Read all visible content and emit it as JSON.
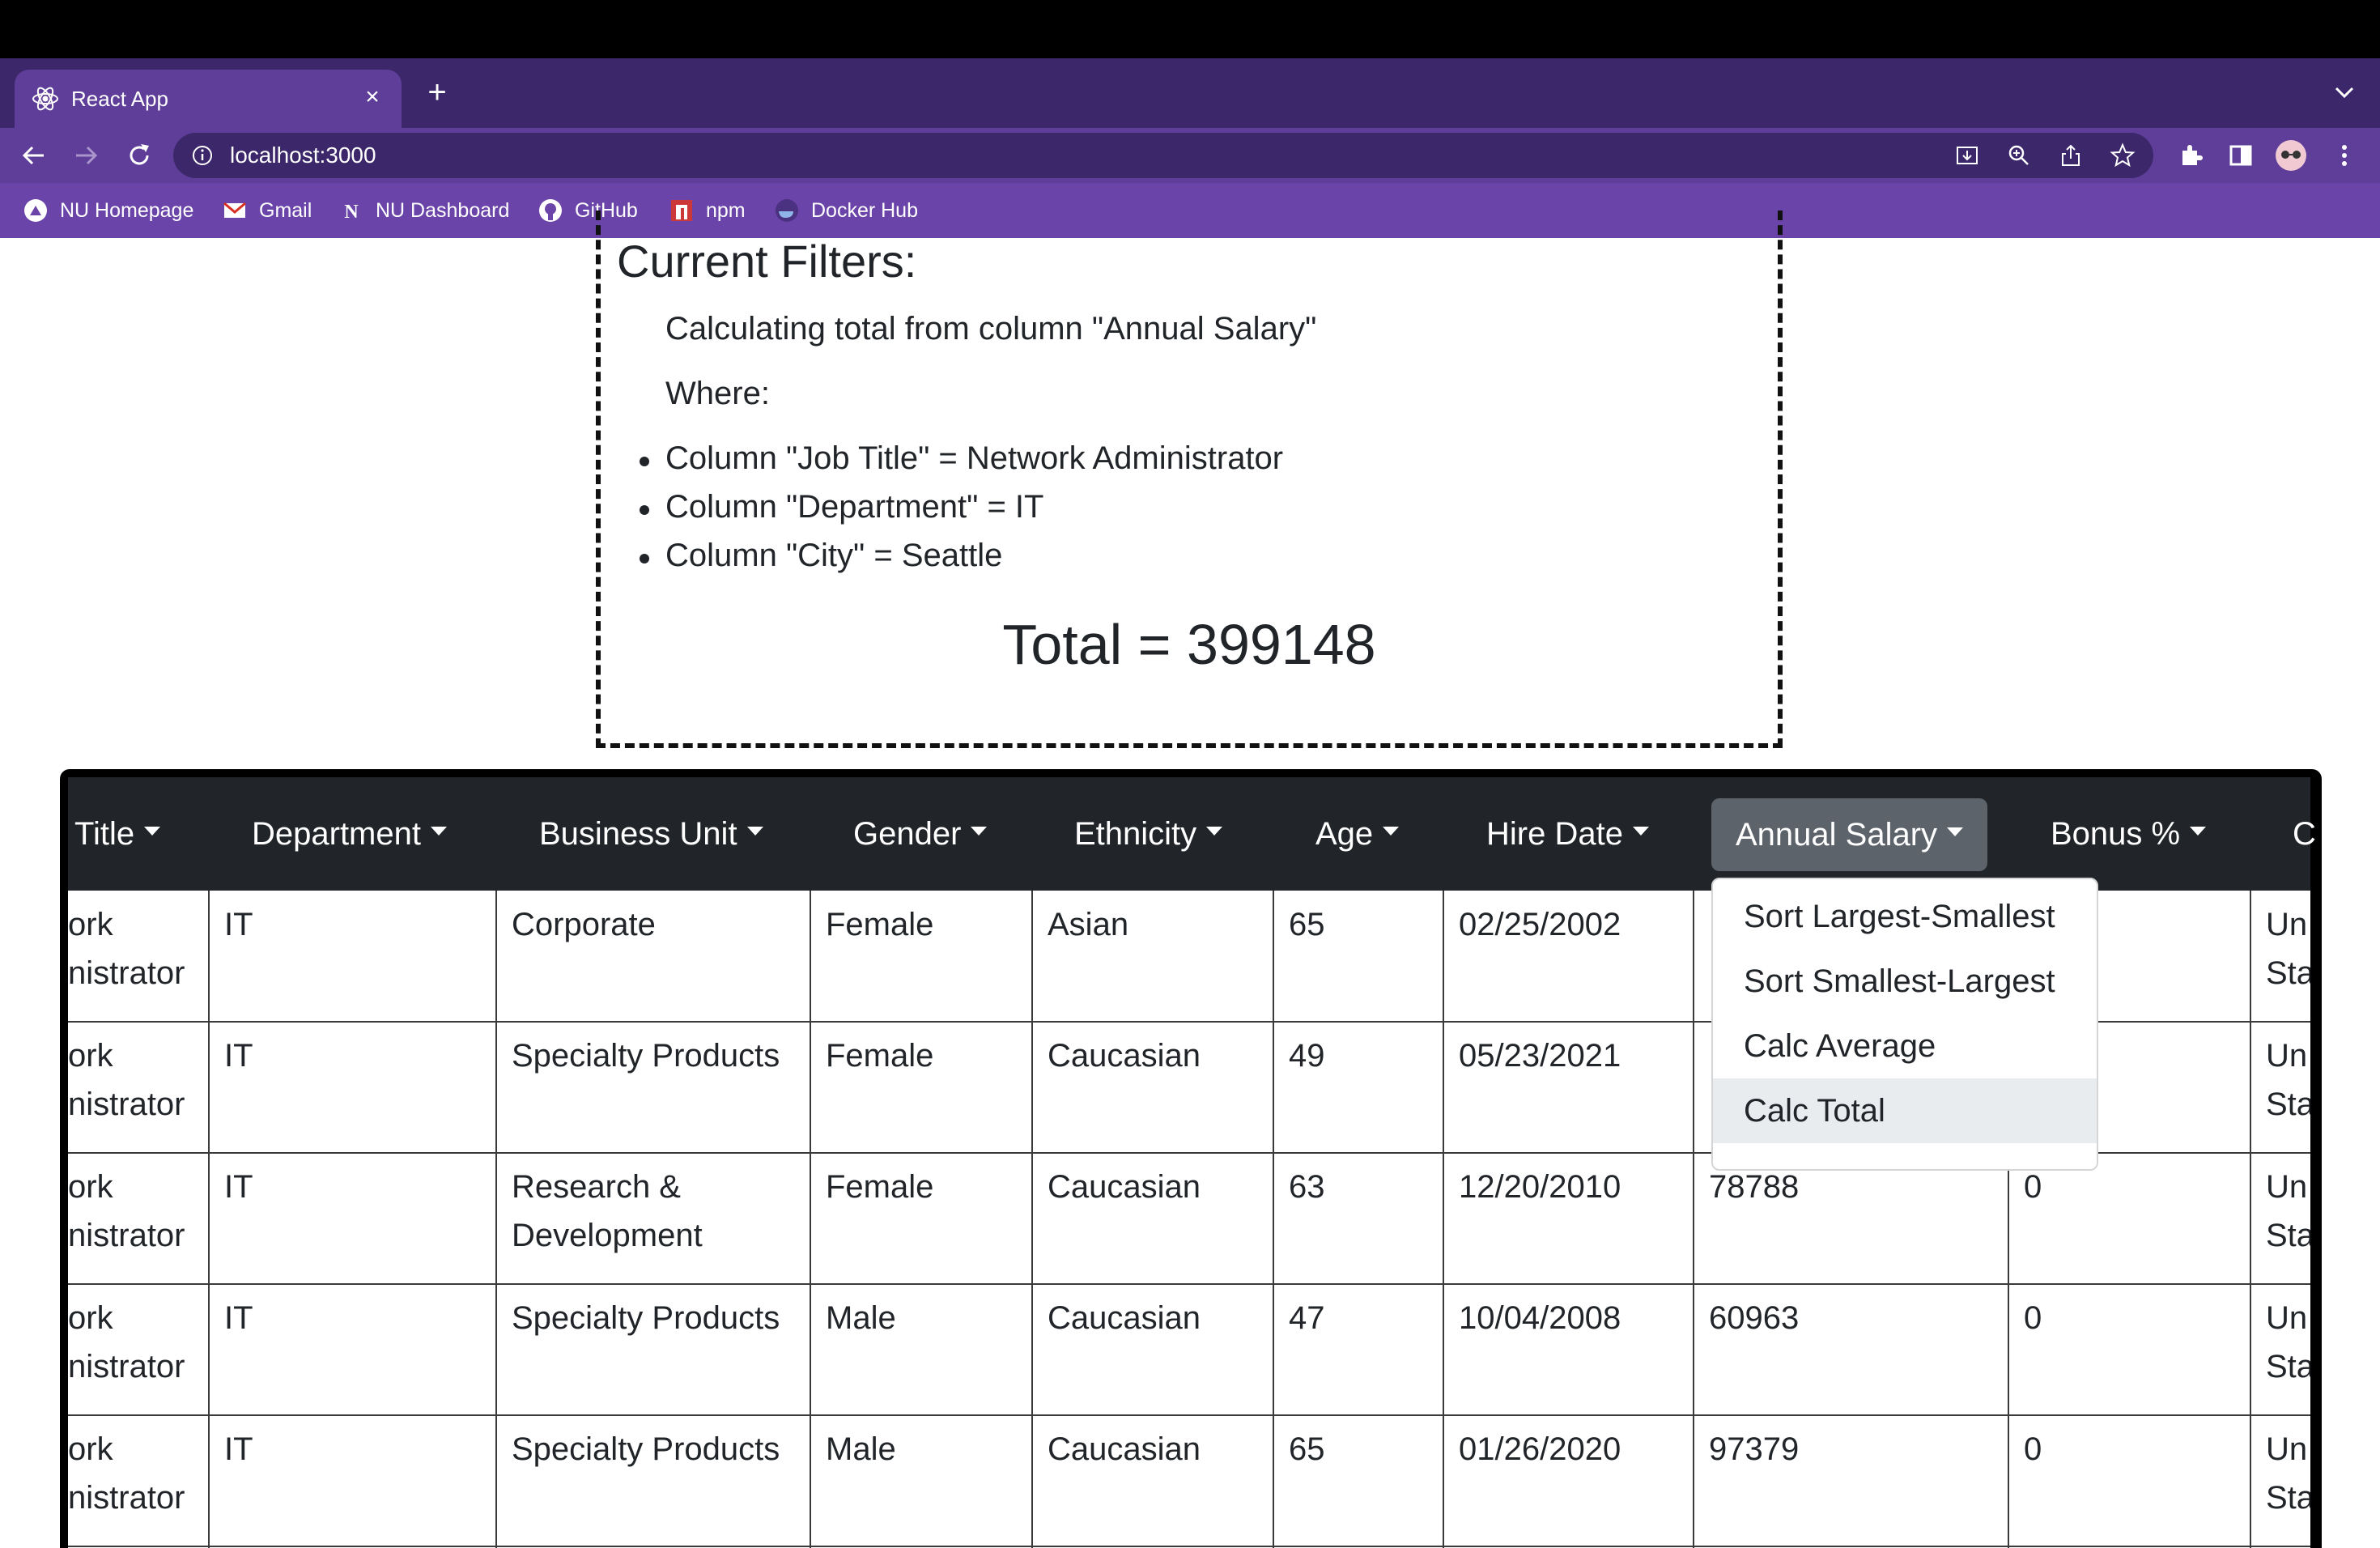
{
  "browser": {
    "tab_title": "React App",
    "url": "localhost:3000",
    "bookmarks": [
      "NU Homepage",
      "Gmail",
      "NU Dashboard",
      "GitHub",
      "npm",
      "Docker Hub"
    ]
  },
  "filters": {
    "heading": "Current Filters:",
    "calc_line": "Calculating total from column \"Annual Salary\"",
    "where_label": "Where:",
    "conditions": [
      "Column \"Job Title\" = Network Administrator",
      "Column \"Department\" = IT",
      "Column \"City\" = Seattle"
    ],
    "total_text": "Total = 399148"
  },
  "table": {
    "headers": [
      "Title",
      "Department",
      "Business Unit",
      "Gender",
      "Ethnicity",
      "Age",
      "Hire Date",
      "Annual Salary",
      "Bonus %",
      "C"
    ],
    "rows": [
      {
        "title1": "ork",
        "title2": "nistrator",
        "department": "IT",
        "bu1": "Corporate",
        "bu2": "",
        "gender": "Female",
        "ethnicity": "Asian",
        "age": "65",
        "hire_date": "02/25/2002",
        "salary": "",
        "bonus": "",
        "c1": "Un",
        "c2": "Sta"
      },
      {
        "title1": "ork",
        "title2": "nistrator",
        "department": "IT",
        "bu1": "Specialty Products",
        "bu2": "",
        "gender": "Female",
        "ethnicity": "Caucasian",
        "age": "49",
        "hire_date": "05/23/2021",
        "salary": "",
        "bonus": "",
        "c1": "Un",
        "c2": "Sta"
      },
      {
        "title1": "ork",
        "title2": "nistrator",
        "department": "IT",
        "bu1": "Research &",
        "bu2": "Development",
        "gender": "Female",
        "ethnicity": "Caucasian",
        "age": "63",
        "hire_date": "12/20/2010",
        "salary": "78788",
        "bonus": "0",
        "c1": "Un",
        "c2": "Sta"
      },
      {
        "title1": "ork",
        "title2": "nistrator",
        "department": "IT",
        "bu1": "Specialty Products",
        "bu2": "",
        "gender": "Male",
        "ethnicity": "Caucasian",
        "age": "47",
        "hire_date": "10/04/2008",
        "salary": "60963",
        "bonus": "0",
        "c1": "Un",
        "c2": "Sta"
      },
      {
        "title1": "ork",
        "title2": "nistrator",
        "department": "IT",
        "bu1": "Specialty Products",
        "bu2": "",
        "gender": "Male",
        "ethnicity": "Caucasian",
        "age": "65",
        "hire_date": "01/26/2020",
        "salary": "97379",
        "bonus": "0",
        "c1": "Un",
        "c2": "Sta"
      }
    ]
  },
  "dropdown": {
    "items": [
      "Sort Largest-Smallest",
      "Sort Smallest-Largest",
      "Calc Average",
      "Calc Total"
    ]
  }
}
